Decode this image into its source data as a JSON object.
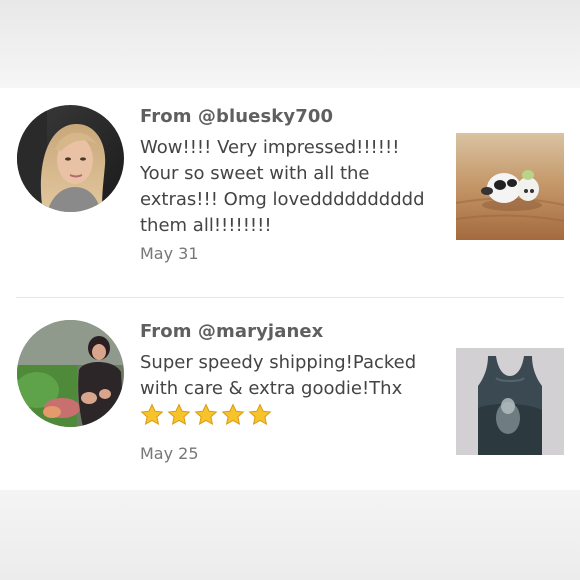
{
  "reviews": [
    {
      "from": "From @bluesky700",
      "text": "Wow!!!! Very impressed!!!!!! Your so sweet with all the extras!!! Omg lovedddddddddd them all!!!!!!!!",
      "date": "May 31",
      "avatar_icon": "user-avatar-photo",
      "item_icon": "figurine-photo"
    },
    {
      "from": "From @maryjanex",
      "text": "Super speedy shipping!Packed with care & extra goodie!Thx",
      "rating": 5,
      "date": "May 25",
      "avatar_icon": "user-avatar-photo",
      "item_icon": "tank-top-photo"
    }
  ],
  "colors": {
    "card_bg": "#ffffff",
    "username": "#5f5f5f",
    "body_text": "#444444",
    "date": "#777777",
    "star": "#f7c32a",
    "divider": "#e7e7e7"
  }
}
